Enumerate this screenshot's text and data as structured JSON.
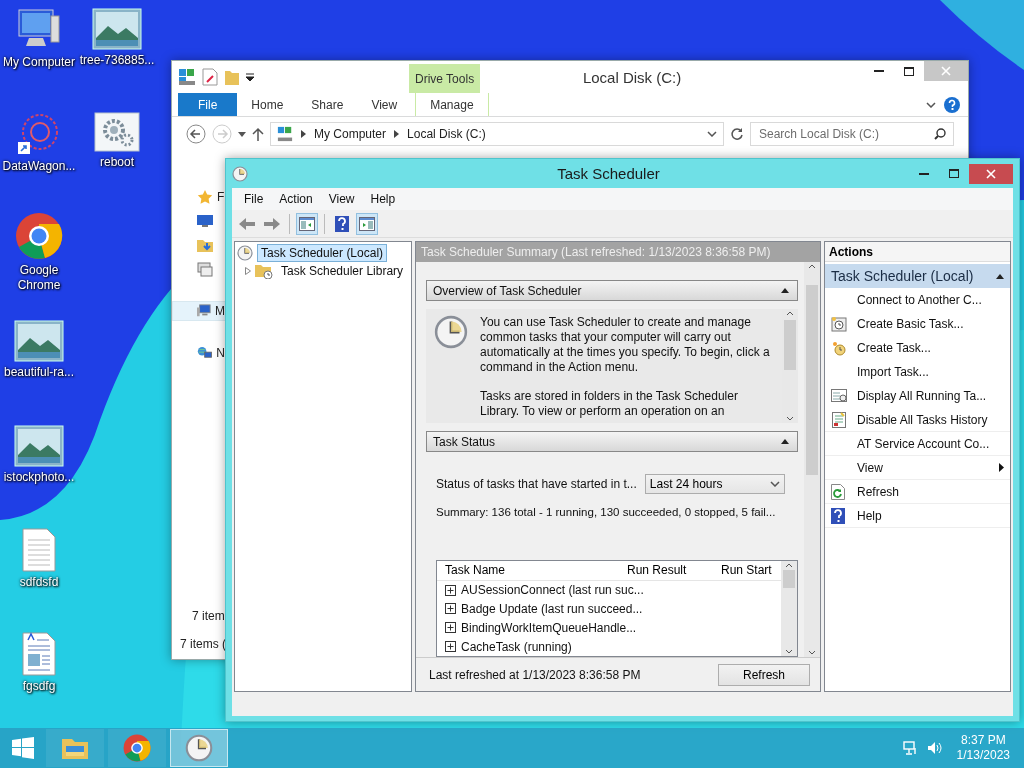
{
  "desktop_icons": [
    {
      "label": "My Computer",
      "kind": "computer"
    },
    {
      "label": "tree-736885...",
      "kind": "image"
    },
    {
      "label": "DataWagon...",
      "kind": "web"
    },
    {
      "label": "reboot",
      "kind": "settings"
    },
    {
      "label": "Google Chrome",
      "kind": "chrome"
    },
    {
      "label": "beautiful-ra...",
      "kind": "image"
    },
    {
      "label": "istockphoto...",
      "kind": "image"
    },
    {
      "label": "sdfdsfd",
      "kind": "text"
    },
    {
      "label": "fgsdfg",
      "kind": "document"
    }
  ],
  "explorer": {
    "title": "Local Disk (C:)",
    "context_tab": "Drive Tools",
    "ribbon_tabs": [
      {
        "label": "File",
        "kind": "file"
      },
      {
        "label": "Home",
        "kind": "tab"
      },
      {
        "label": "Share",
        "kind": "tab"
      },
      {
        "label": "View",
        "kind": "tab"
      },
      {
        "label": "Manage",
        "kind": "context"
      }
    ],
    "breadcrumb": [
      "My Computer",
      "Local Disk (C:)"
    ],
    "search": {
      "placeholder": "Search Local Disk (C:)"
    },
    "nav_items": [
      {
        "label": "F",
        "kind": "favorites",
        "selected": false
      },
      {
        "kind": "desktop",
        "selected": false
      },
      {
        "kind": "downloads",
        "selected": false
      },
      {
        "kind": "recent",
        "selected": false
      },
      {
        "label": "M",
        "kind": "computer",
        "selected": true
      },
      {
        "label": "N",
        "kind": "network",
        "selected": false
      }
    ],
    "item_count": "7 item",
    "status": "7 items ("
  },
  "task_scheduler": {
    "title": "Task Scheduler",
    "menu": [
      "File",
      "Action",
      "View",
      "Help"
    ],
    "toolbar": [
      {
        "kind": "back",
        "on": false
      },
      {
        "kind": "forward",
        "on": false
      },
      {
        "kind": "tree-pane",
        "on": true
      },
      {
        "kind": "help",
        "on": false
      },
      {
        "kind": "action-pane",
        "on": true
      }
    ],
    "tree": [
      {
        "label": "Task Scheduler (Local)",
        "selected": true,
        "children": [
          {
            "label": "Task Scheduler Library",
            "selected": false,
            "expanded": false
          }
        ]
      }
    ],
    "summary_header": "Task Scheduler Summary (Last refreshed: 1/13/2023 8:36:58 PM)",
    "overview": {
      "title": "Overview of Task Scheduler",
      "expanded": true,
      "paragraphs": [
        "You can use Task Scheduler to create and manage common tasks that your computer will carry out automatically at the times you specify. To begin, click a command in the Action menu.",
        "Tasks are stored in folders in the Task Scheduler Library. To view or perform an operation on an"
      ]
    },
    "task_status": {
      "title": "Task Status",
      "expanded": true,
      "filter_label": "Status of tasks that have started in t...",
      "filter": "Last 24 hours",
      "summary": "Summary: 136 total - 1 running, 130 succeeded, 0 stopped, 5 fail...",
      "columns": [
        "Task Name",
        "Run Result",
        "Run Start"
      ],
      "rows": [
        {
          "name": "AUSessionConnect (last run suc...",
          "expanded": false
        },
        {
          "name": "Badge Update (last run succeed...",
          "expanded": false
        },
        {
          "name": "BindingWorkItemQueueHandle...",
          "expanded": false
        },
        {
          "name": "CacheTask (running)",
          "expanded": false
        }
      ]
    },
    "last_refreshed": "Last refreshed at 1/13/2023 8:36:58 PM",
    "refresh_button": "Refresh",
    "actions": {
      "title": "Actions",
      "group": "Task Scheduler (Local)",
      "expanded": true,
      "items": [
        {
          "label": "Connect to Another C...",
          "kind": "plain"
        },
        {
          "label": "Create Basic Task...",
          "kind": "basic-task"
        },
        {
          "label": "Create Task...",
          "kind": "create-task"
        },
        {
          "label": "Import Task...",
          "kind": "plain"
        },
        {
          "label": "Display All Running Ta...",
          "kind": "running"
        },
        {
          "label": "Disable All Tasks History",
          "kind": "history"
        },
        {
          "label": "AT Service Account Co...",
          "kind": "plain"
        },
        {
          "label": "View",
          "kind": "submenu"
        },
        {
          "label": "Refresh",
          "kind": "refresh"
        },
        {
          "label": "Help",
          "kind": "help"
        }
      ]
    }
  },
  "taskbar": {
    "apps": [
      {
        "kind": "explorer",
        "selected": false
      },
      {
        "kind": "chrome",
        "selected": false
      },
      {
        "kind": "clock",
        "selected": true
      }
    ],
    "time": "8:37 PM",
    "date": "1/13/2023"
  }
}
